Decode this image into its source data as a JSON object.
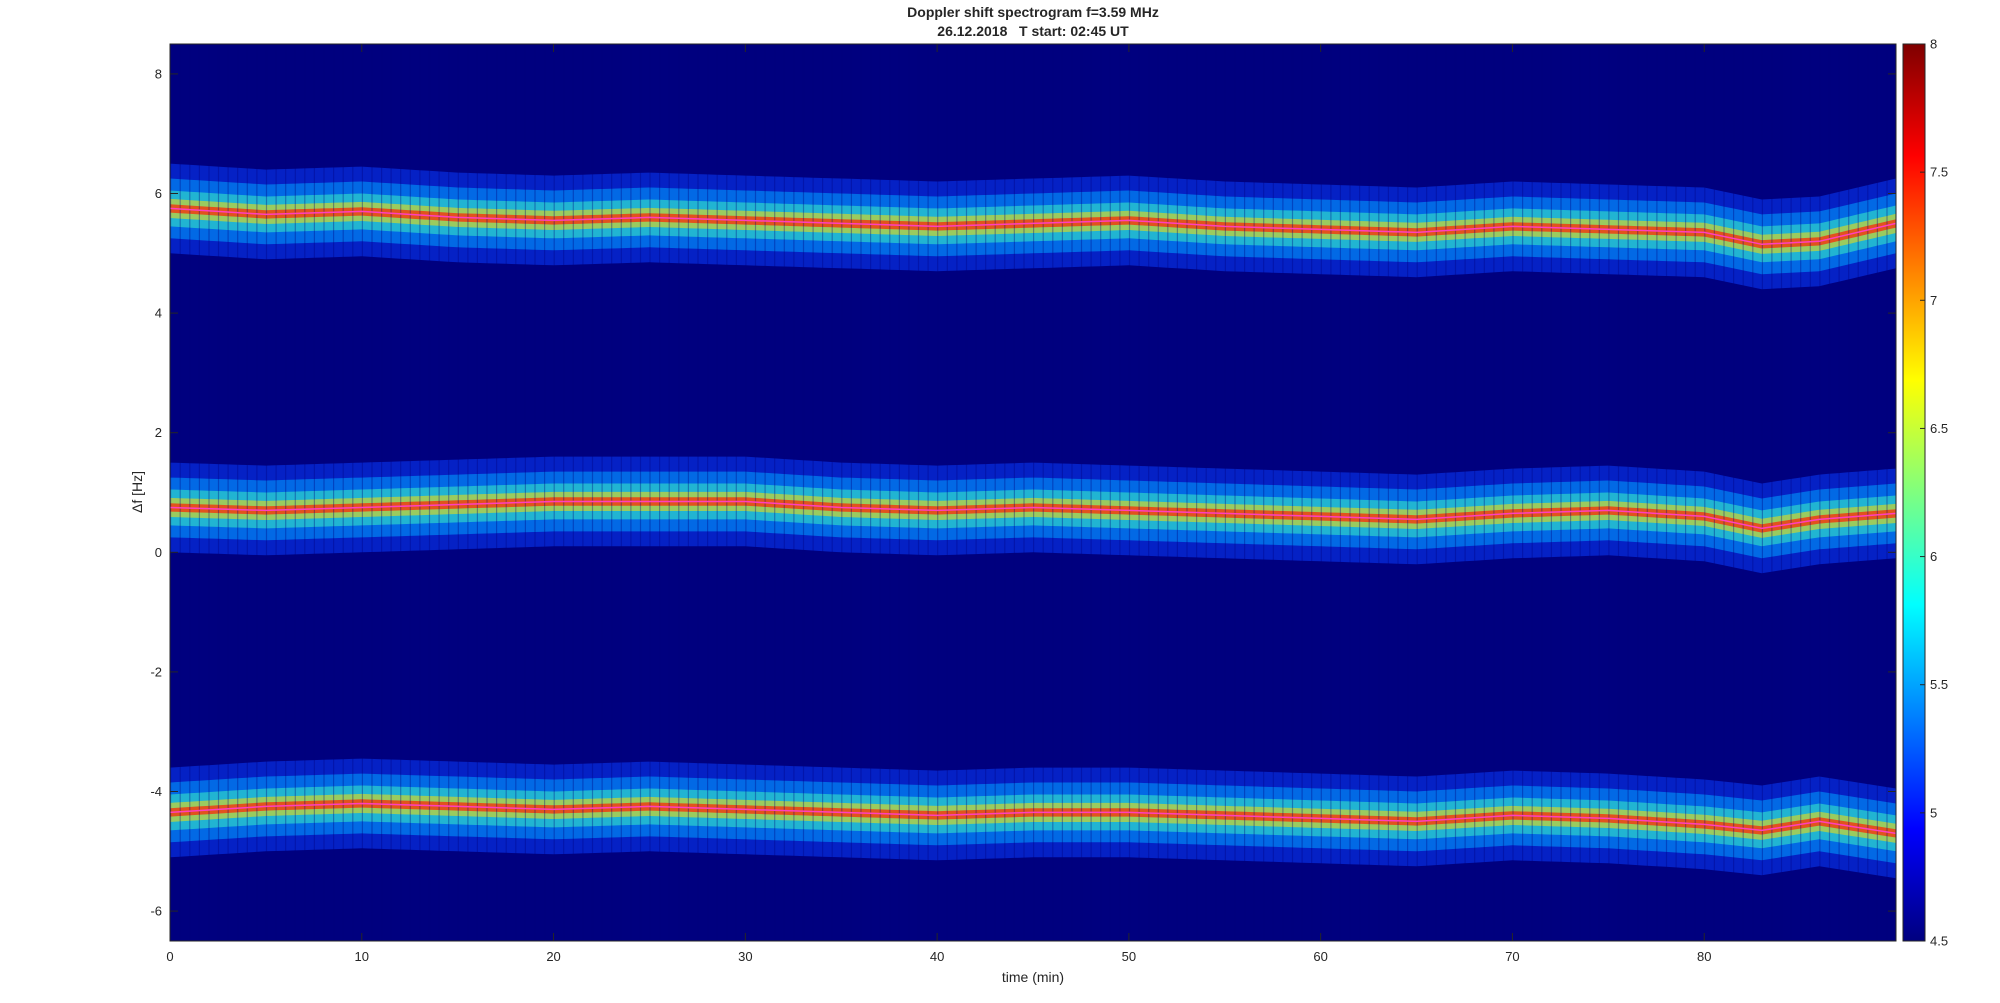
{
  "chart_data": {
    "type": "heatmap",
    "title": "Doppler shift spectrogram f=3.59 MHz",
    "subtitle": "26.12.2018   T start: 02:45 UT",
    "xlabel": "time (min)",
    "ylabel": "Δf [Hz]",
    "xlim": [
      0,
      90
    ],
    "ylim": [
      -6.5,
      8.5
    ],
    "xticks": [
      0,
      10,
      20,
      30,
      40,
      50,
      60,
      70,
      80
    ],
    "yticks": [
      -6,
      -4,
      -2,
      0,
      2,
      4,
      6,
      8
    ],
    "colorbar": {
      "colormap": "jet",
      "limits": [
        4.5,
        8
      ],
      "ticks": [
        4.5,
        5,
        5.5,
        6,
        6.5,
        7,
        7.5,
        8
      ]
    },
    "grid": false,
    "background_color": "#00007f",
    "series": [
      {
        "time": [
          0,
          5,
          10,
          15,
          20,
          25,
          30,
          35,
          40,
          45,
          50,
          55,
          60,
          65,
          70,
          75,
          80,
          83,
          86,
          90
        ],
        "df": [
          5.75,
          5.65,
          5.7,
          5.6,
          5.55,
          5.6,
          5.55,
          5.5,
          5.45,
          5.5,
          5.55,
          5.45,
          5.4,
          5.35,
          5.45,
          5.4,
          5.35,
          5.15,
          5.2,
          5.5
        ]
      },
      {
        "time": [
          0,
          5,
          10,
          15,
          20,
          25,
          30,
          35,
          40,
          45,
          50,
          55,
          60,
          65,
          70,
          75,
          80,
          83,
          86,
          90
        ],
        "df": [
          0.75,
          0.7,
          0.75,
          0.8,
          0.85,
          0.85,
          0.85,
          0.75,
          0.7,
          0.75,
          0.7,
          0.65,
          0.6,
          0.55,
          0.65,
          0.7,
          0.6,
          0.4,
          0.55,
          0.65
        ]
      },
      {
        "time": [
          0,
          5,
          10,
          15,
          20,
          25,
          30,
          35,
          40,
          45,
          50,
          55,
          60,
          65,
          70,
          75,
          80,
          83,
          86,
          90
        ],
        "df": [
          -4.35,
          -4.25,
          -4.2,
          -4.25,
          -4.3,
          -4.25,
          -4.3,
          -4.35,
          -4.4,
          -4.35,
          -4.35,
          -4.4,
          -4.45,
          -4.5,
          -4.4,
          -4.45,
          -4.55,
          -4.65,
          -4.5,
          -4.7
        ]
      }
    ]
  }
}
